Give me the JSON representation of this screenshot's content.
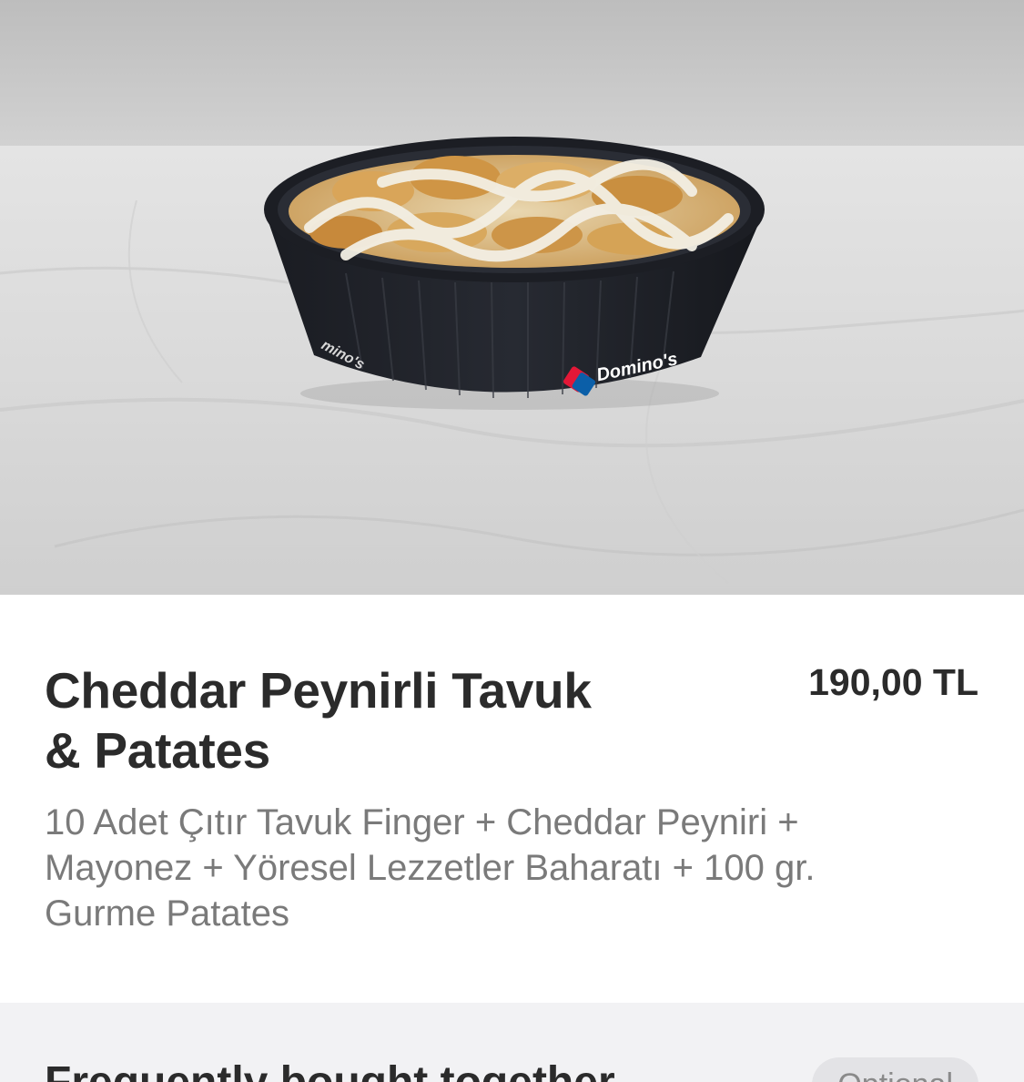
{
  "hero": {
    "brand_text": "Domino's",
    "brand_text_side": "mino's"
  },
  "product": {
    "title": "Cheddar Peynirli Tavuk & Patates",
    "price": "190,00 TL",
    "description": "10 Adet Çıtır Tavuk Finger + Cheddar Peyniri + Mayonez + Yöresel Lezzetler Baharatı + 100 gr. Gurme Patates"
  },
  "frequently_bought": {
    "title": "Frequently bought together",
    "badge": "Optional"
  },
  "colors": {
    "title_text": "#2b2b2b",
    "description_text": "#7a7a7a",
    "section_background": "#f2f2f4",
    "badge_background": "#e3e3e6"
  }
}
